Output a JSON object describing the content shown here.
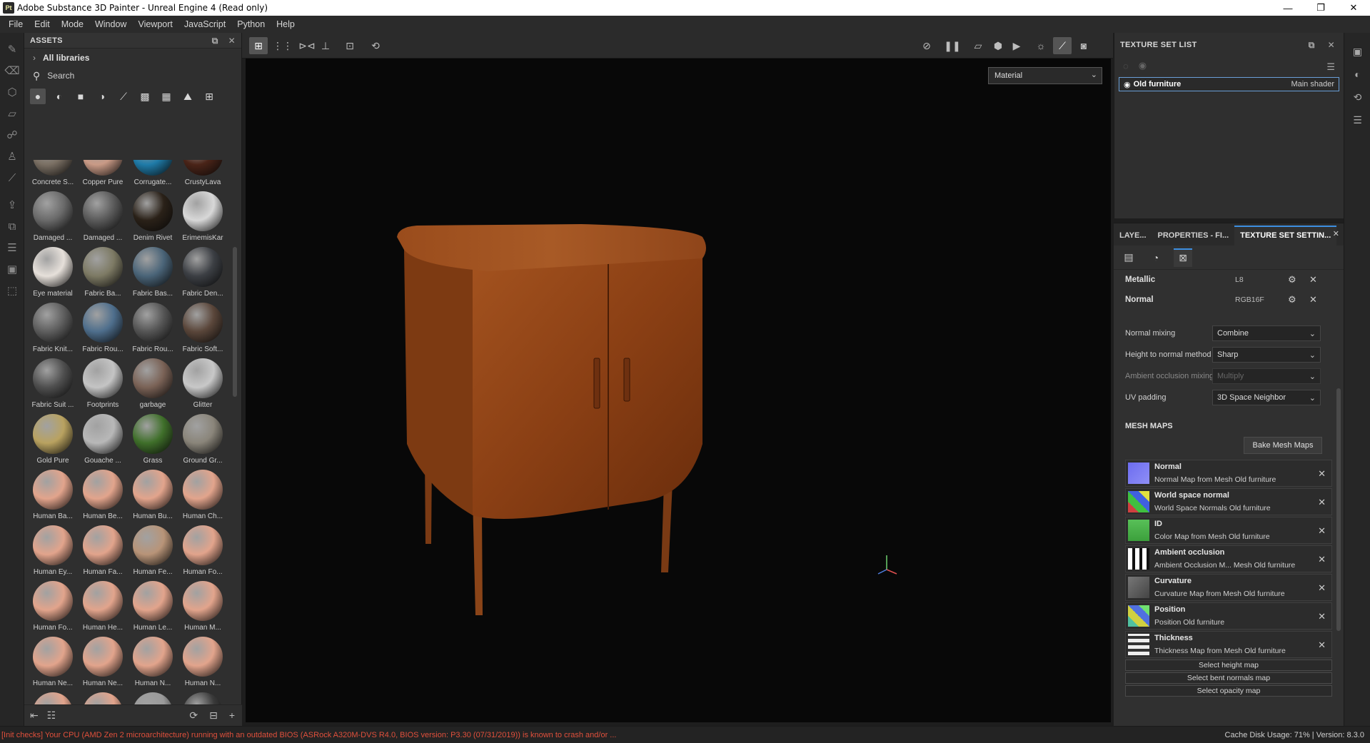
{
  "window": {
    "app_badge": "Pt",
    "title": "Adobe Substance 3D Painter - Unreal Engine 4 (Read only)",
    "minimize": "—",
    "maximize": "❐",
    "close": "✕"
  },
  "menu": [
    "File",
    "Edit",
    "Mode",
    "Window",
    "Viewport",
    "JavaScript",
    "Python",
    "Help"
  ],
  "assets": {
    "title": "ASSETS",
    "libraries": "All libraries",
    "search_placeholder": "Search",
    "materials": [
      {
        "label": "Concrete S...",
        "color": "#7a6f63"
      },
      {
        "label": "Copper Pure",
        "color": "#c99a86"
      },
      {
        "label": "Corrugate...",
        "color": "#1f7ba8"
      },
      {
        "label": "CrustyLava",
        "color": "#4a2418"
      },
      {
        "label": "Damaged ...",
        "color": "#6a6a6a"
      },
      {
        "label": "Damaged ...",
        "color": "#5a5a5a"
      },
      {
        "label": "Denim Rivet",
        "color": "#2a2118"
      },
      {
        "label": "ErimemisKar",
        "color": "#d8d8d8"
      },
      {
        "label": "Eye material",
        "color": "#e6e0da"
      },
      {
        "label": "Fabric Ba...",
        "color": "#7d7a64"
      },
      {
        "label": "Fabric Bas...",
        "color": "#4a6478"
      },
      {
        "label": "Fabric Den...",
        "color": "#3c3f44"
      },
      {
        "label": "Fabric Knit...",
        "color": "#5e5e5e"
      },
      {
        "label": "Fabric Rou...",
        "color": "#4e6e8c"
      },
      {
        "label": "Fabric Rou...",
        "color": "#555555"
      },
      {
        "label": "Fabric Soft...",
        "color": "#5a463a"
      },
      {
        "label": "Fabric Suit ...",
        "color": "#4f4f4f"
      },
      {
        "label": "Footprints",
        "color": "#c4c4c4"
      },
      {
        "label": "garbage",
        "color": "#7a6256"
      },
      {
        "label": "Glitter",
        "color": "#c8c8c8"
      },
      {
        "label": "Gold Pure",
        "color": "#b9a260"
      },
      {
        "label": "Gouache ...",
        "color": "#b8b8b8"
      },
      {
        "label": "Grass",
        "color": "#3f6f2a"
      },
      {
        "label": "Ground Gr...",
        "color": "#8a857a"
      },
      {
        "label": "Human Ba...",
        "color": "#e2a48c"
      },
      {
        "label": "Human Be...",
        "color": "#e2a48c"
      },
      {
        "label": "Human Bu...",
        "color": "#e2a48c"
      },
      {
        "label": "Human Ch...",
        "color": "#e2a48c"
      },
      {
        "label": "Human Ey...",
        "color": "#e2a48c"
      },
      {
        "label": "Human Fa...",
        "color": "#e2a48c"
      },
      {
        "label": "Human Fe...",
        "color": "#b89478"
      },
      {
        "label": "Human Fo...",
        "color": "#e2a48c"
      },
      {
        "label": "Human Fo...",
        "color": "#e2a48c"
      },
      {
        "label": "Human He...",
        "color": "#e2a48c"
      },
      {
        "label": "Human Le...",
        "color": "#e2a48c"
      },
      {
        "label": "Human M...",
        "color": "#e2a48c"
      },
      {
        "label": "Human Ne...",
        "color": "#e2a48c"
      },
      {
        "label": "Human Ne...",
        "color": "#e2a48c"
      },
      {
        "label": "Human N...",
        "color": "#e2a48c"
      },
      {
        "label": "Human N...",
        "color": "#e2a48c"
      },
      {
        "label": "",
        "color": "#e2a48c"
      },
      {
        "label": "",
        "color": "#e2a48c"
      },
      {
        "label": "",
        "color": "#9a9a9a"
      },
      {
        "label": "",
        "color": "#3a3a3a"
      }
    ]
  },
  "viewport": {
    "mode": "Material"
  },
  "texture_set_list": {
    "title": "TEXTURE SET LIST",
    "item_name": "Old furniture",
    "item_shader": "Main shader"
  },
  "tabs": [
    "LAYE...",
    "PROPERTIES - FI...",
    "TEXTURE SET SETTIN..."
  ],
  "texture_set_settings": {
    "channels": [
      {
        "name": "Metallic",
        "format": "L8"
      },
      {
        "name": "Normal",
        "format": "RGB16F"
      }
    ],
    "props": [
      {
        "label": "Normal mixing",
        "value": "Combine",
        "disabled": false
      },
      {
        "label": "Height to normal method",
        "value": "Sharp",
        "disabled": false
      },
      {
        "label": "Ambient occlusion mixing",
        "value": "Multiply",
        "disabled": true
      },
      {
        "label": "UV padding",
        "value": "3D Space Neighbor",
        "disabled": false
      }
    ],
    "mesh_maps_title": "MESH MAPS",
    "bake_label": "Bake Mesh Maps",
    "mesh_maps": [
      {
        "name": "Normal",
        "source": "Normal Map from Mesh Old furniture"
      },
      {
        "name": "World space normal",
        "source": "World Space Normals Old furniture"
      },
      {
        "name": "ID",
        "source": "Color Map from Mesh Old furniture"
      },
      {
        "name": "Ambient occlusion",
        "source": "Ambient Occlusion M... Mesh Old furniture"
      },
      {
        "name": "Curvature",
        "source": "Curvature Map from Mesh Old furniture"
      },
      {
        "name": "Position",
        "source": "Position Old furniture"
      },
      {
        "name": "Thickness",
        "source": "Thickness Map from Mesh Old furniture"
      }
    ],
    "select_buttons": [
      "Select height map",
      "Select bent normals map",
      "Select opacity map"
    ]
  },
  "status": {
    "warning": "[Init checks] Your CPU (AMD Zen 2 microarchitecture) running with an outdated BIOS (ASRock A320M-DVS R4.0, BIOS version: P3.30 (07/31/2019)) is known to crash and/or ...",
    "cache": "Cache Disk Usage:   71% | Version: 8.3.0"
  }
}
